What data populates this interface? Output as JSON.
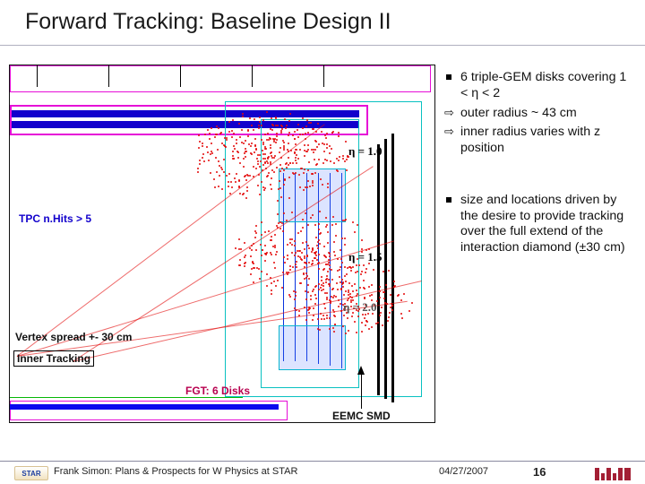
{
  "title": "Forward Tracking: Baseline Design II",
  "figure": {
    "eta10": "η = 1.0",
    "eta15": "η = 1.5",
    "eta20": "η = 2.0",
    "tpc": "TPC n.Hits > 5",
    "vertex": "Vertex spread +- 30 cm",
    "inner": "Inner Tracking",
    "fgt": "FGT: 6 Disks",
    "eemc": "EEMC SMD"
  },
  "bullets": {
    "b1": "6 triple-GEM disks covering 1 < η < 2",
    "a1": "outer radius ~ 43 cm",
    "a2": "inner radius varies with z position",
    "b2": "size and locations driven by the desire to provide tracking over the full extend of the interaction diamond (±30 cm)"
  },
  "footer": {
    "author": "Frank Simon: Plans & Prospects for W Physics at STAR",
    "date": "04/27/2007",
    "page": "16",
    "star": "STAR"
  }
}
